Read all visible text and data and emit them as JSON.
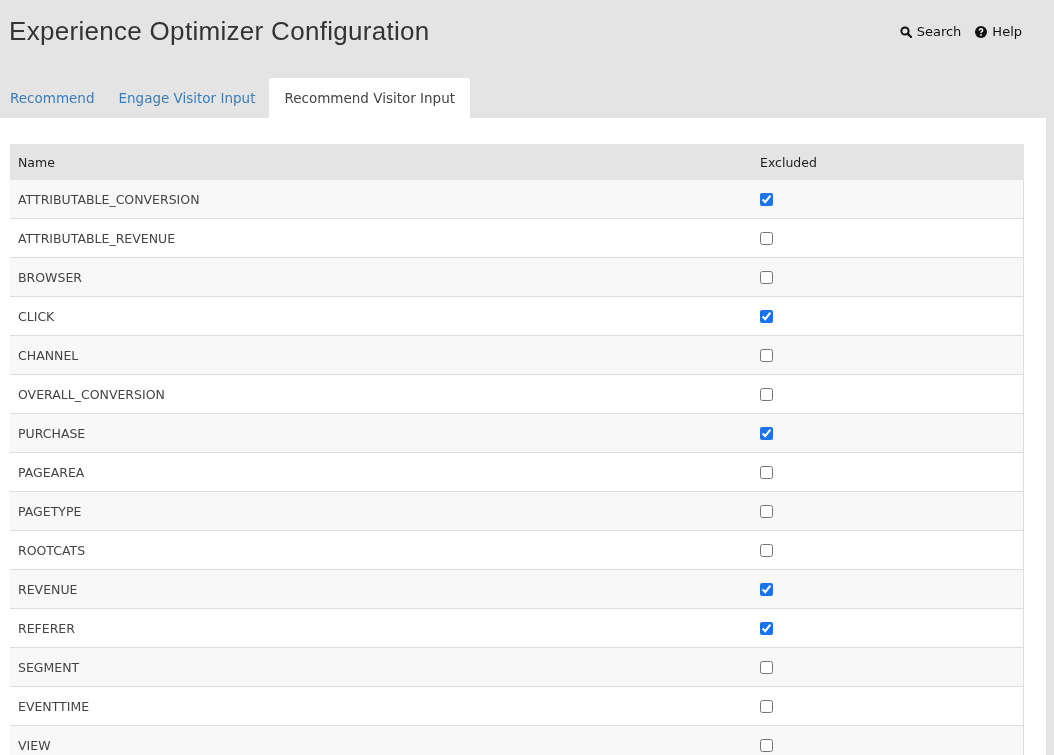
{
  "header": {
    "title": "Experience Optimizer Configuration",
    "links": [
      {
        "kind": "search",
        "label": "Search"
      },
      {
        "kind": "help",
        "label": "Help"
      }
    ]
  },
  "tabs": [
    {
      "label": "Recommend",
      "selected": false
    },
    {
      "label": "Engage Visitor Input",
      "selected": false
    },
    {
      "label": "Recommend Visitor Input",
      "selected": true
    }
  ],
  "table": {
    "columns": [
      "Name",
      "Excluded"
    ],
    "rows": [
      {
        "name": "ATTRIBUTABLE_CONVERSION",
        "excluded": true
      },
      {
        "name": "ATTRIBUTABLE_REVENUE",
        "excluded": false
      },
      {
        "name": "BROWSER",
        "excluded": false
      },
      {
        "name": "CLICK",
        "excluded": true
      },
      {
        "name": "CHANNEL",
        "excluded": false
      },
      {
        "name": "OVERALL_CONVERSION",
        "excluded": false
      },
      {
        "name": "PURCHASE",
        "excluded": true
      },
      {
        "name": "PAGEAREA",
        "excluded": false
      },
      {
        "name": "PAGETYPE",
        "excluded": false
      },
      {
        "name": "ROOTCATS",
        "excluded": false
      },
      {
        "name": "REVENUE",
        "excluded": true
      },
      {
        "name": "REFERER",
        "excluded": true
      },
      {
        "name": "SEGMENT",
        "excluded": false
      },
      {
        "name": "EVENTTIME",
        "excluded": false
      },
      {
        "name": "VIEW",
        "excluded": false
      }
    ]
  }
}
